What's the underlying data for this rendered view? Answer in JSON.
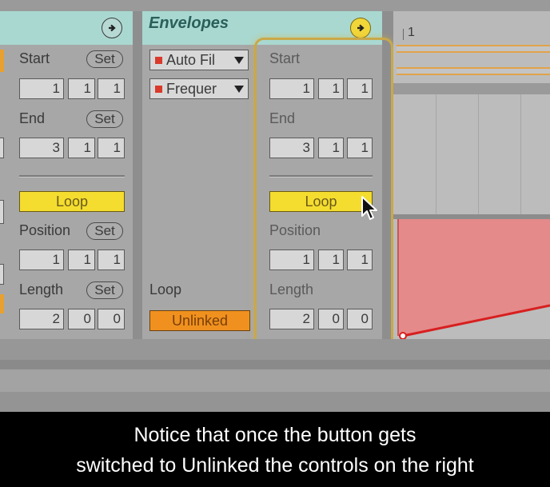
{
  "left_panel": {
    "start_label": "Start",
    "set_label": "Set",
    "start_values": [
      "1",
      "1",
      "1"
    ],
    "end_label": "End",
    "end_values": [
      "3",
      "1",
      "1"
    ],
    "loop_label": "Loop",
    "position_label": "Position",
    "position_values": [
      "1",
      "1",
      "1"
    ],
    "length_label": "Length",
    "length_values": [
      "2",
      "0",
      "0"
    ]
  },
  "envelopes": {
    "title": "Envelopes",
    "device_chooser": "Auto Fil",
    "parameter_chooser": "Frequer",
    "loop_label": "Loop",
    "unlinked_label": "Unlinked",
    "start_label": "Start",
    "start_values": [
      "1",
      "1",
      "1"
    ],
    "end_label": "End",
    "end_values": [
      "3",
      "1",
      "1"
    ],
    "loop_button": "Loop",
    "position_label": "Position",
    "position_values": [
      "1",
      "1",
      "1"
    ],
    "length_label": "Length",
    "length_values": [
      "2",
      "0",
      "0"
    ]
  },
  "arrangement": {
    "ruler_marker": "1"
  },
  "caption": {
    "line1": "Notice that once the button gets",
    "line2": "switched to Unlinked the controls on the right"
  },
  "colors": {
    "header_teal": "#a9d8d0",
    "loop_yellow": "#f4dd2e",
    "unlinked_orange": "#f0911f",
    "envelope_red": "#e46a6a"
  }
}
